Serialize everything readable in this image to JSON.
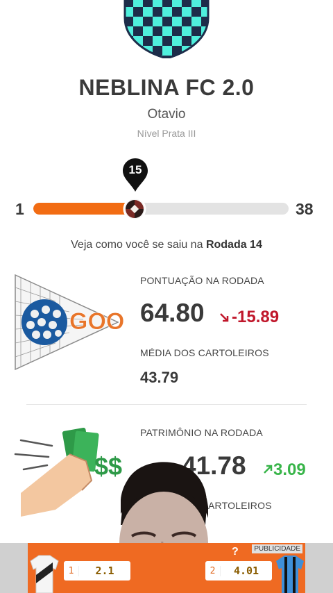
{
  "team": {
    "name": "NEBLINA FC 2.0",
    "owner": "Otavio",
    "level": "Nível Prata III"
  },
  "progress": {
    "current_round": "15",
    "min": "1",
    "max": "38",
    "fraction": 0.39
  },
  "round_summary": {
    "prefix": "Veja como você se saiu na",
    "round": "Rodada 14"
  },
  "score": {
    "label": "PONTUAÇÃO NA RODADA",
    "value": "64.80",
    "delta": "-15.89",
    "avg_label": "MÉDIA DOS CARTOLEIROS",
    "avg_value": "43.79",
    "illustration_text": "GOOL"
  },
  "patrimony": {
    "label": "PATRIMÔNIO NA RODADA",
    "value_partial": "41.78",
    "delta": "3.09",
    "avg_label_partial": "ARTOLEIROS",
    "illustration_text": "$$"
  },
  "ad": {
    "tag": "PUBLICIDADE",
    "question": "?",
    "odds": [
      {
        "n": "1",
        "v": "2.1"
      },
      {
        "n": "2",
        "v": "4.01"
      }
    ]
  },
  "colors": {
    "accent": "#f26c13",
    "negative": "#c0172b",
    "positive": "#39b54a",
    "crest_teal": "#4ff0dd",
    "crest_navy": "#1d2d4a"
  }
}
